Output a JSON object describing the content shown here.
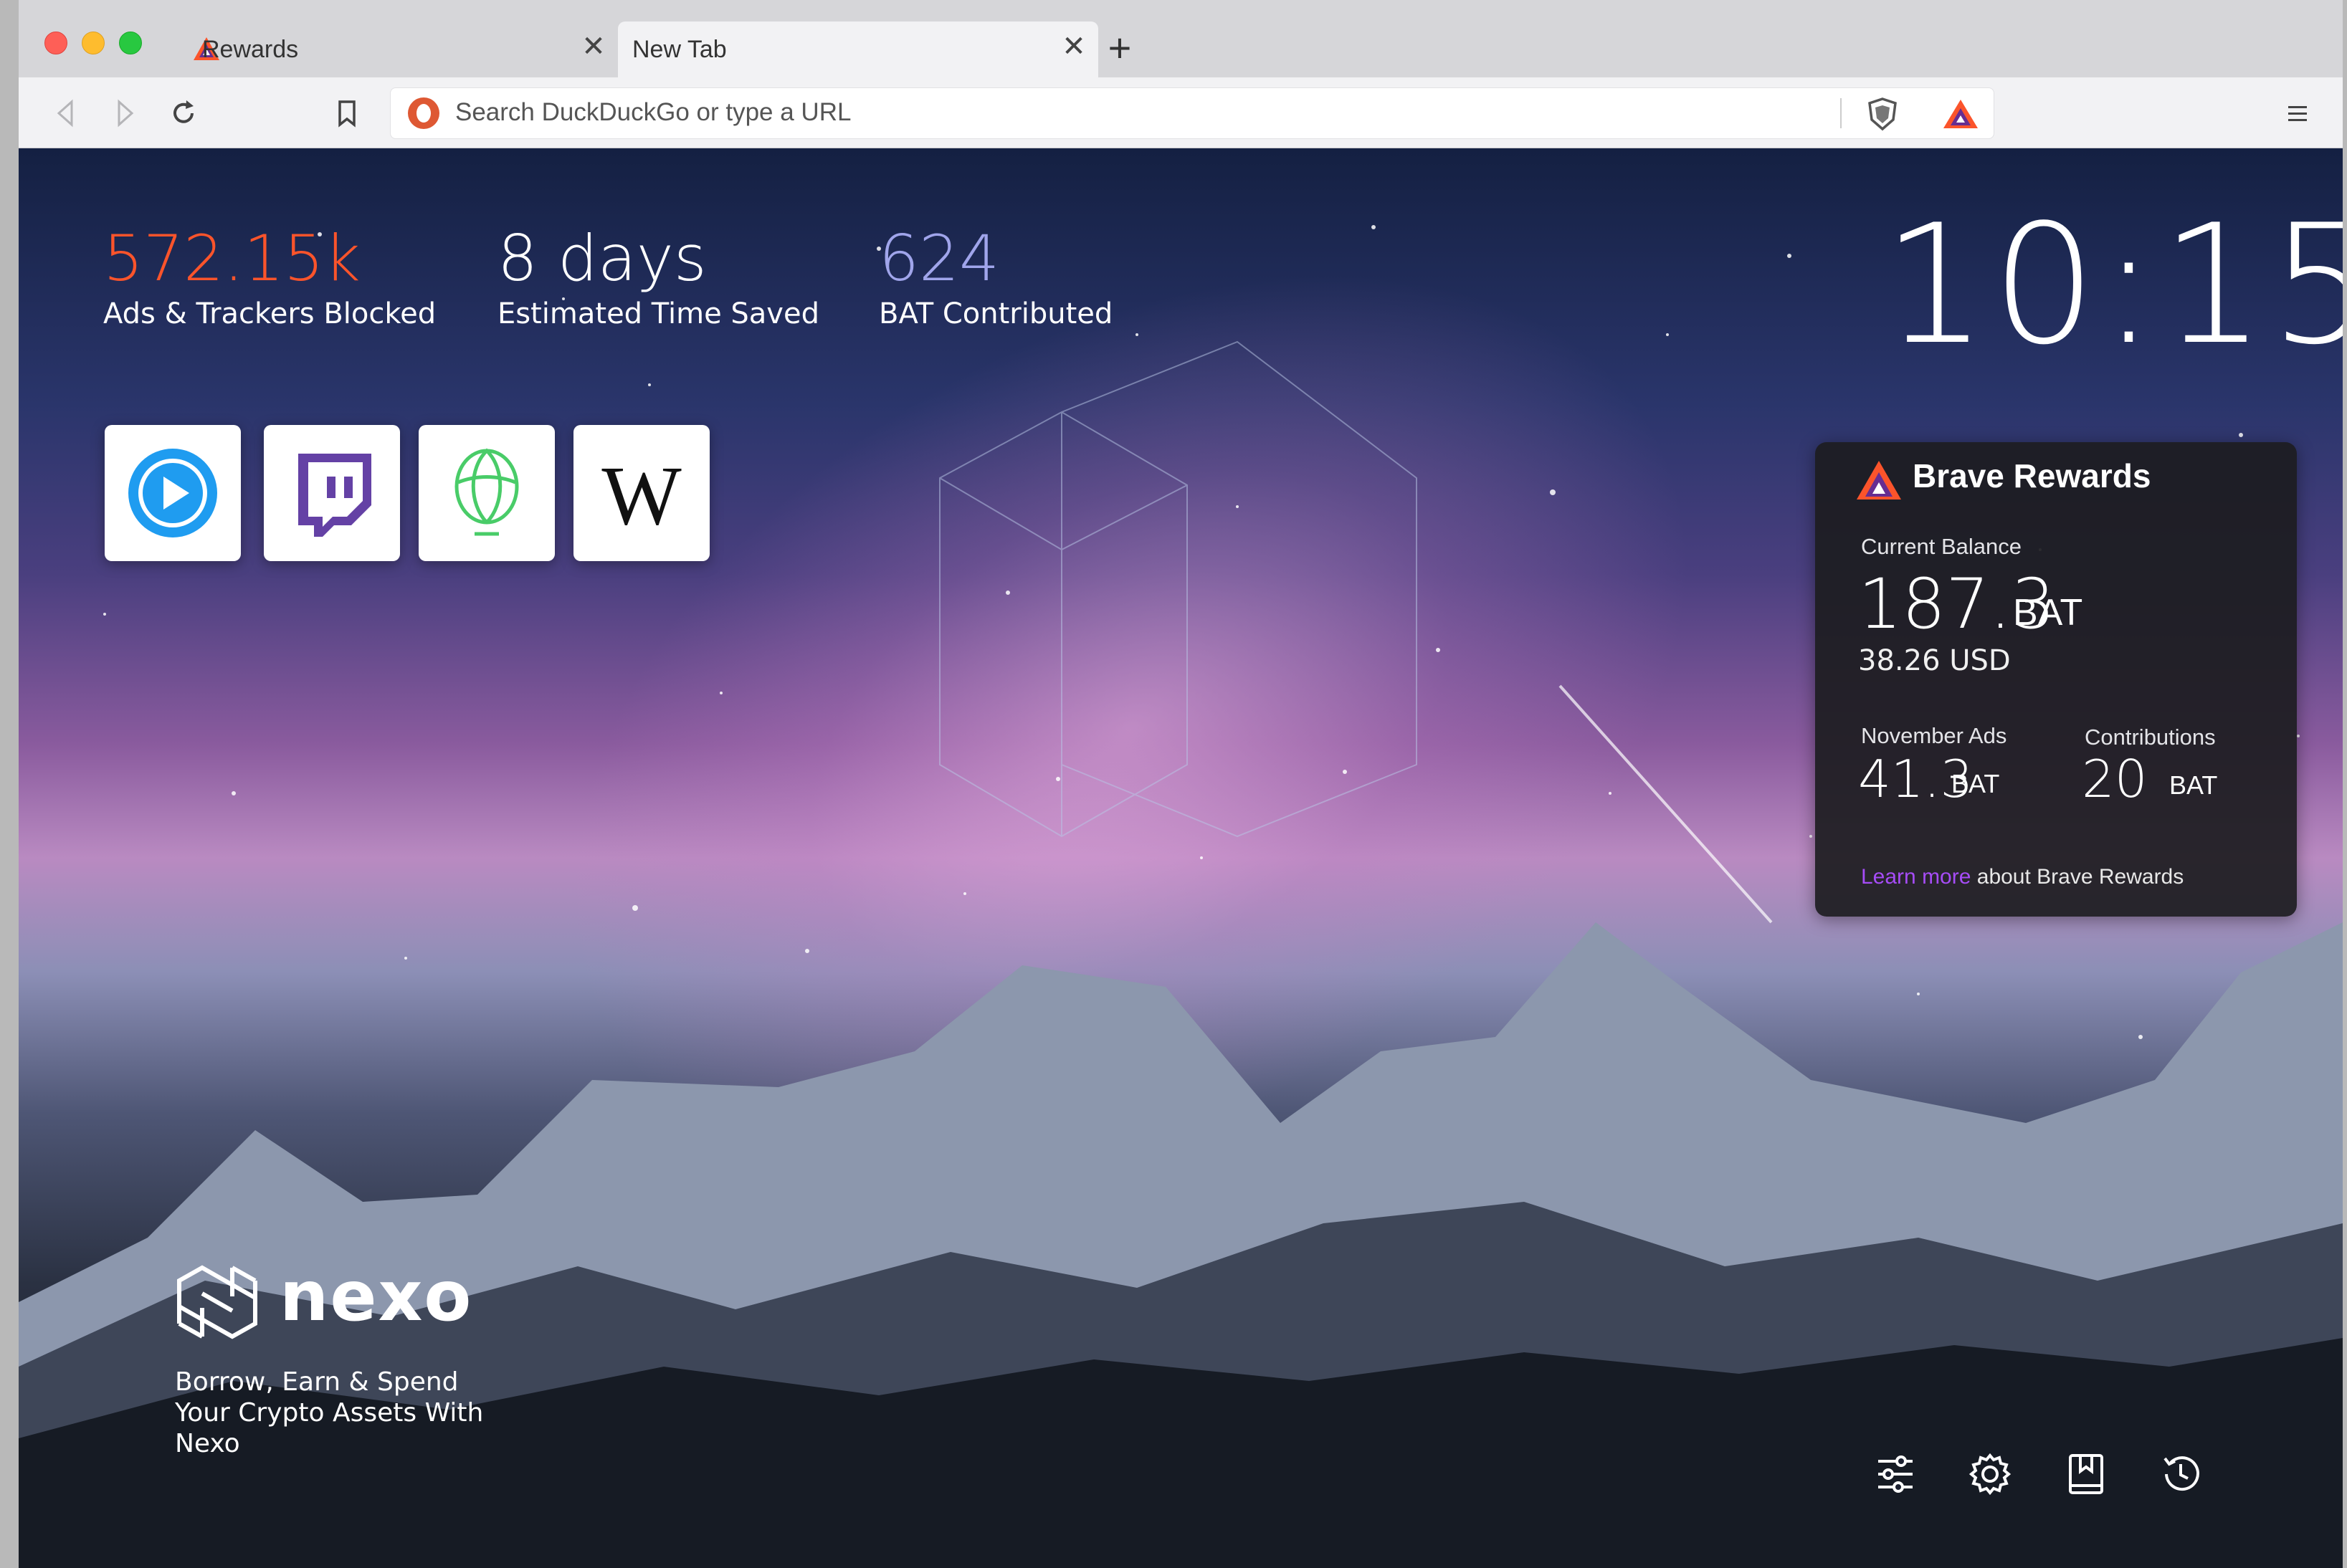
{
  "browser": {
    "tabs": [
      {
        "label": "Rewards",
        "active": false,
        "icon": "brave-bat-icon"
      },
      {
        "label": "New Tab",
        "active": true
      }
    ],
    "new_tab_symbol": "+",
    "close_symbol": "✕",
    "url_placeholder": "Search DuckDuckGo or type a URL",
    "search_engine_icon": "duckduckgo-icon"
  },
  "stats": {
    "blocked": {
      "value": "572.15k",
      "label": "Ads & Trackers Blocked",
      "color": "#fb542b"
    },
    "time_saved": {
      "value": "8 days",
      "label": "Estimated Time Saved",
      "color": "#ffffff"
    },
    "bat": {
      "value": "624",
      "label": "BAT Contributed",
      "color": "#a0a5eb"
    }
  },
  "clock": "10:15",
  "top_sites": [
    {
      "name": "play-site-icon"
    },
    {
      "name": "twitch-icon"
    },
    {
      "name": "uphold-icon"
    },
    {
      "name": "wikipedia-icon"
    }
  ],
  "rewards": {
    "title": "Brave Rewards",
    "balance_label": "Current Balance",
    "balance_value": "187.3",
    "balance_unit": "BAT",
    "balance_usd": "38.26 USD",
    "ads_label": "November Ads",
    "ads_value": "41.3",
    "ads_unit": "BAT",
    "contrib_label": "Contributions",
    "contrib_value": "20",
    "contrib_unit": "BAT",
    "learn_more": "Learn more",
    "learn_more_rest": " about Brave Rewards"
  },
  "sponsor": {
    "name": "nexo",
    "tagline": "Borrow, Earn & Spend Your Crypto Assets With Nexo"
  },
  "bottom_icons": [
    "customize-icon",
    "settings-icon",
    "bookmarks-icon",
    "history-icon"
  ]
}
